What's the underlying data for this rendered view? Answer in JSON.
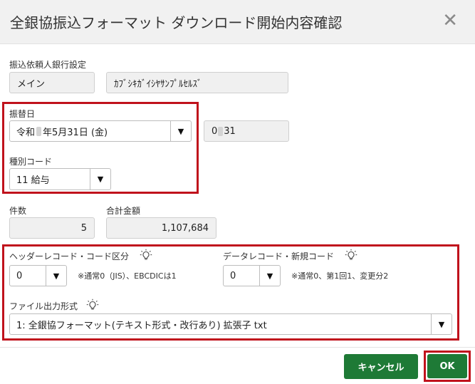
{
  "dialog": {
    "title": "全銀協振込フォーマット ダウンロード開始内容確認",
    "close_symbol": "✕"
  },
  "requester_bank": {
    "label": "振込依頼人銀行設定",
    "name_value": "メイン",
    "kana_value": "ｶﾌﾞｼｷｶﾞｲｼﾔｻﾝﾌﾟﾙｾﾙｽﾞ"
  },
  "transfer_date": {
    "label": "振替日",
    "era": "令和",
    "date_rest": "年5月31日 (金)",
    "code_prefix": "0",
    "code_suffix": "31"
  },
  "type_code": {
    "label": "種別コード",
    "value": "11 給与"
  },
  "count": {
    "label": "件数",
    "value": "5"
  },
  "total": {
    "label": "合計金額",
    "value": "1,107,684"
  },
  "header_record": {
    "label": "ヘッダーレコード・コード区分",
    "value": "0",
    "hint": "※通常0（JIS）、EBCDICは1",
    "icon": "lightbulb-icon"
  },
  "data_record": {
    "label": "データレコード・新規コード",
    "value": "0",
    "hint": "※通常0、第1回1、変更分2",
    "icon": "lightbulb-icon"
  },
  "file_format": {
    "label": "ファイル出力形式",
    "value": "1: 全銀協フォーマット(テキスト形式・改行あり) 拡張子 txt",
    "icon": "lightbulb-icon"
  },
  "dropdown_arrow": "▼",
  "buttons": {
    "cancel": "キャンセル",
    "ok": "OK"
  },
  "colors": {
    "accent_green": "#1e7a36",
    "highlight_red": "#c0121c"
  }
}
